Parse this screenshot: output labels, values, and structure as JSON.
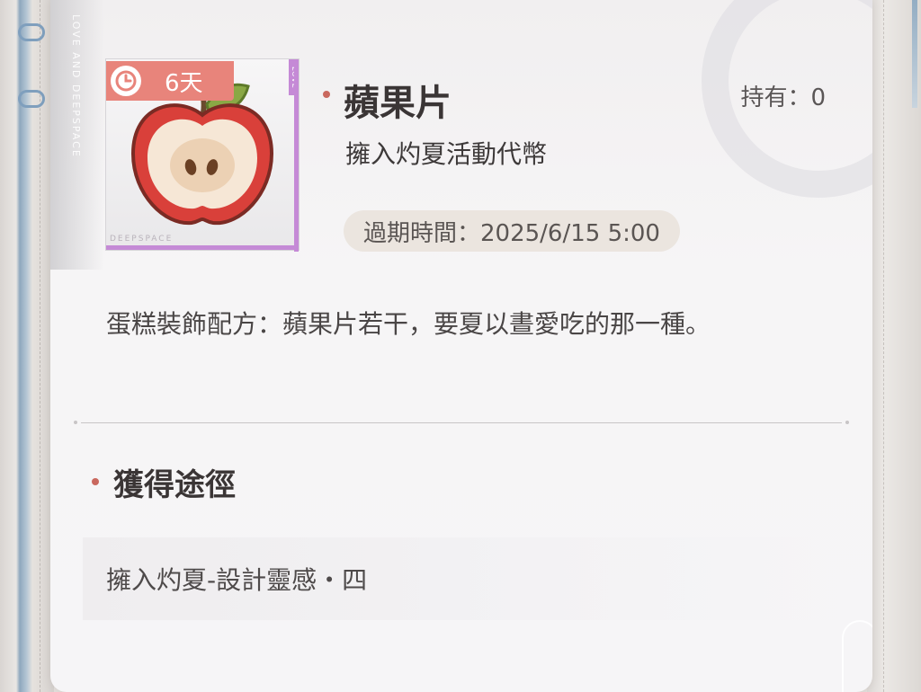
{
  "item": {
    "name": "蘋果片",
    "subtitle": "擁入灼夏活動代幣",
    "holding": "持有：0",
    "expiry": "過期時間：2025/6/15 5:00",
    "timer_days": "6天",
    "description": "蛋糕裝飾配方：蘋果片若干，要夏以晝愛吃的那一種。",
    "icon": "apple-slice-icon"
  },
  "brand": {
    "vertical": "LOVE AND DEEPSPACE",
    "tag": "LOVE",
    "foot": "DEEPSPACE"
  },
  "acquisition": {
    "title": "獲得途徑",
    "sources": [
      "擁入灼夏-設計靈感・四"
    ]
  },
  "colors": {
    "accent_red": "#c9685e",
    "badge": "#e8847b",
    "rarity_purple": "#c58ad6"
  }
}
